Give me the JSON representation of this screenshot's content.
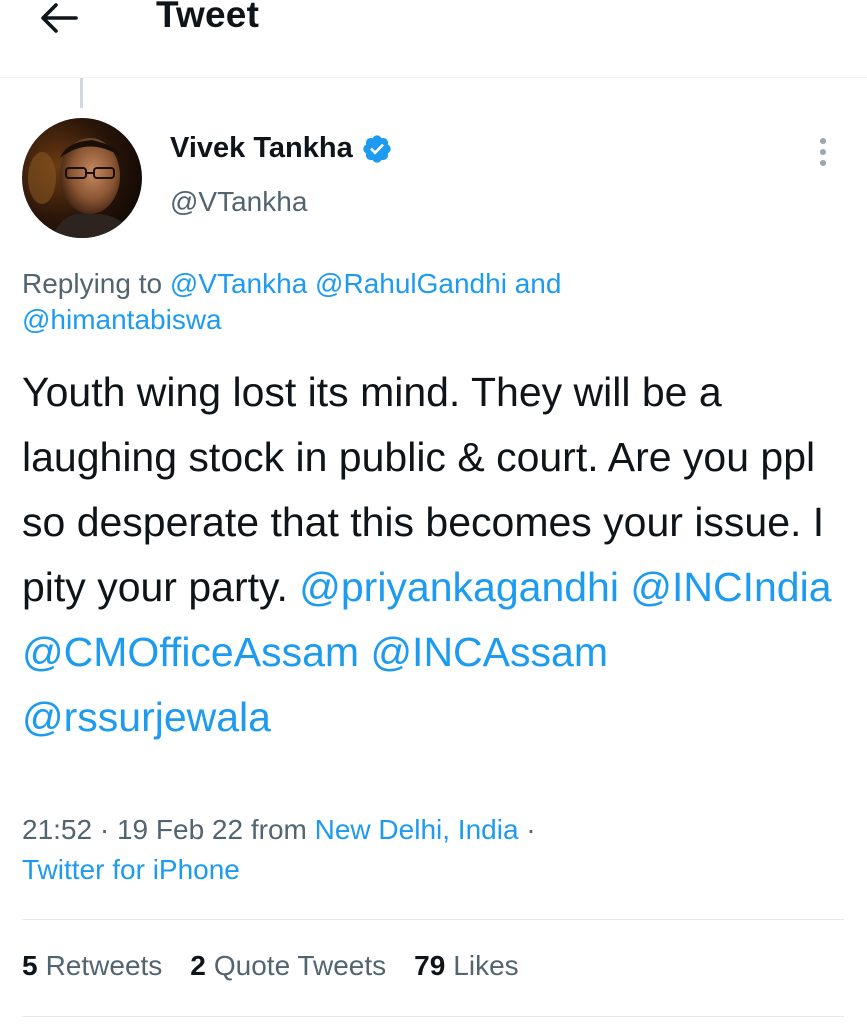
{
  "header": {
    "title": "Tweet",
    "back_icon": "arrow-left-icon"
  },
  "author": {
    "name": "Vivek Tankha",
    "handle": "@VTankha",
    "verified_icon": "verified-badge-icon",
    "verified_color": "#1d9bf0"
  },
  "replying": {
    "prefix": "Replying to",
    "mentions": [
      "@VTankha",
      "@RahulGandhi"
    ],
    "conjunction": "and",
    "last_mention": "@himantabiswa"
  },
  "tweet": {
    "text": "Youth wing lost its mind. They will be a laughing stock in public & court. Are you ppl so desperate that this becomes your issue. I pity your party.",
    "mentions": [
      "@priyankagandhi",
      "@INCIndia",
      "@CMOfficeAssam",
      "@INCAssam",
      "@rssurjewala"
    ]
  },
  "meta": {
    "time": "21:52",
    "date": "19 Feb 22",
    "from": "from",
    "location": "New Delhi, India",
    "source": "Twitter for iPhone"
  },
  "stats": {
    "retweets": {
      "count": "5",
      "label": "Retweets"
    },
    "quotes": {
      "count": "2",
      "label": "Quote Tweets"
    },
    "likes": {
      "count": "79",
      "label": "Likes"
    }
  },
  "colors": {
    "link": "#1d9bf0",
    "secondary_text": "#536471",
    "primary_text": "#0f1419"
  }
}
